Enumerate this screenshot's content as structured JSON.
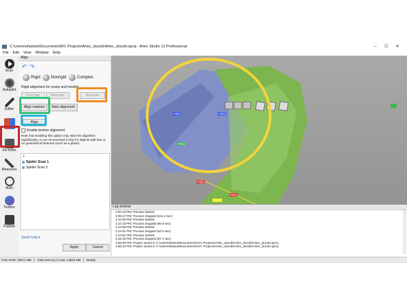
{
  "window": {
    "title": "C:\\Users\\efastow\\Documents\\AFL Projects\\Artec_dozuki\\Artec_dozuki.sproj - Artec Studio 12 Professional",
    "min": "–",
    "max": "☐",
    "close": "✕"
  },
  "menu": [
    "File",
    "Edit",
    "View",
    "Window",
    "Help"
  ],
  "left_tools": [
    {
      "name": "scan",
      "label": "Scan",
      "icon": "play-icon"
    },
    {
      "name": "autopilot",
      "label": "Autopilot",
      "icon": "autopilot-icon"
    },
    {
      "name": "editor",
      "label": "Editor",
      "icon": "brush-icon"
    },
    {
      "name": "align",
      "label": "",
      "icon": "align-icon"
    },
    {
      "name": "fixholes",
      "label": "Fix holes",
      "icon": "fix-holes-icon"
    },
    {
      "name": "measures",
      "label": "Measures",
      "icon": "ruler-icon"
    },
    {
      "name": "multi",
      "label": "Multi",
      "icon": "multi-icon"
    },
    {
      "name": "texture",
      "label": "Texture",
      "icon": "texture-icon"
    },
    {
      "name": "publish",
      "label": "Publish",
      "icon": "publish-icon"
    }
  ],
  "align_panel": {
    "title": "Align",
    "modes": [
      "Rigid",
      "Nonrigid",
      "Complex"
    ],
    "subtitle": "Rigid alignment for scans and models",
    "prev_pair": "Prev pair",
    "next_pair": "Next pair",
    "new_pair": "New pair",
    "align_markers": "Align markers",
    "auto_alignment": "Auto-alignment",
    "align": "Align",
    "checkbox_label": "Enable texture alignment",
    "note": "Note that enabling this option may slow the algorithm significantly, so we recommend it only for objects with few or no geometrical features (such as a plane).",
    "list_header": "#",
    "scans": [
      "Spider Scan 1",
      "Spider Scan 2"
    ],
    "quick_help": "Quick help",
    "apply": "Apply",
    "cancel": "Cancel"
  },
  "viewport": {
    "markers": [
      "#6[3]",
      "#6[2]",
      "#4[2]",
      "#4[1]",
      "#6[1]"
    ]
  },
  "log_window": {
    "title": "Log window",
    "lines": [
      "2:02:16 PM: Preview started",
      "2:06:17 PM: Process stopped (241.2 sec)",
      "2:10:36 PM: Preview started",
      "2:12:15 PM: Process stopped (98.9 sec)",
      "2:12:58 PM: Preview started",
      "2:14:01 PM: Process stopped (63.0 sec)",
      "2:14:51 PM: Preview started",
      "2:16:18 PM: Process stopped (87.1 sec)",
      "2:28:30 PM: Project saved in C:\\Users\\efastow\\Documents\\AFL Projects\\Artec_dozuki\\Artec_dozuki\\Artec_dozuki.sproj",
      "2:58:10 PM: Project saved in C:\\Users\\efastow\\Documents\\AFL Projects\\Artec_dozuki\\Artec_dozuki\\Artec_dozuki.sproj"
    ]
  },
  "status": {
    "free_ram": "Free RAM: 45571 MB",
    "total_mem": "Total memory in use: 14653 MB",
    "state": "Ready"
  },
  "colors": {
    "red_box": "#c0282d",
    "green_box": "#35c47a",
    "cyan_box": "#2ab6d9",
    "orange_box": "#f08c1f",
    "yellow_circle": "#f2d43a"
  }
}
